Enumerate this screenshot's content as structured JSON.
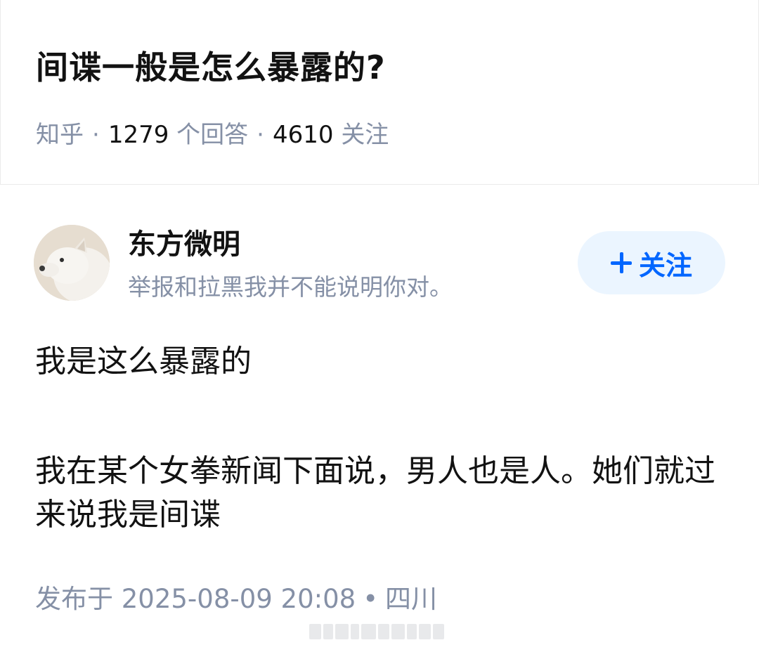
{
  "question": {
    "title": "间谍一般是怎么暴露的?",
    "source": "知乎",
    "answer_count": "1279",
    "answer_label": "个回答",
    "follow_count": "4610",
    "follow_label": "关注"
  },
  "author": {
    "name": "东方微明",
    "bio": "举报和拉黑我并不能说明你对。",
    "follow_button": "关注"
  },
  "answer": {
    "paragraph_1": "我是这么暴露的",
    "paragraph_2": "我在某个女拳新闻下面说，男人也是人。她们就过来说我是间谍",
    "published_prefix": "发布于",
    "published_time": "2025-08-09 20:08",
    "separator": "•",
    "location": "四川"
  }
}
